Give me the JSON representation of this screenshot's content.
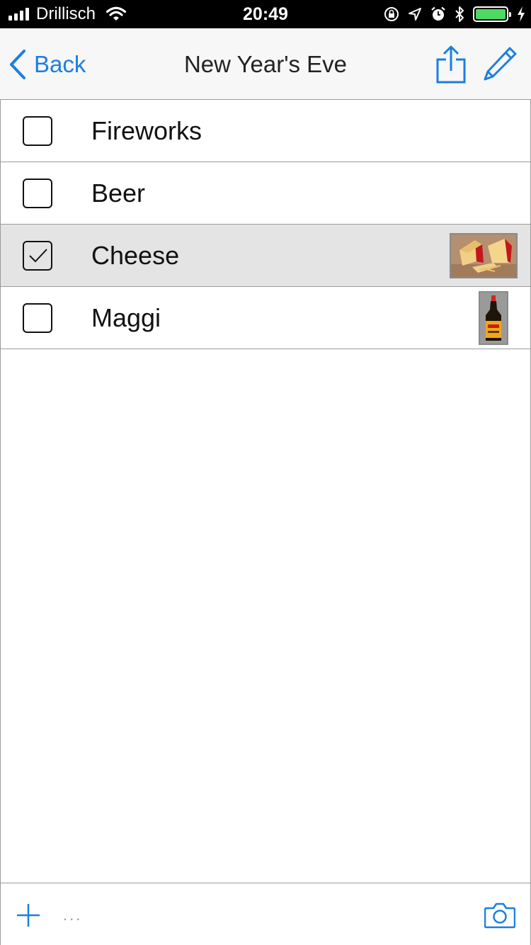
{
  "status_bar": {
    "carrier": "Drillisch",
    "time": "20:49",
    "battery_color": "#4cd964"
  },
  "nav": {
    "back_label": "Back",
    "title": "New Year's Eve",
    "accent_color": "#1a7fe0"
  },
  "items": [
    {
      "label": "Fireworks",
      "checked": false,
      "thumbnail": null
    },
    {
      "label": "Beer",
      "checked": false,
      "thumbnail": null
    },
    {
      "label": "Cheese",
      "checked": true,
      "thumbnail": "cheese-photo"
    },
    {
      "label": "Maggi",
      "checked": false,
      "thumbnail": "maggi-bottle-photo"
    }
  ],
  "toolbar": {
    "more_label": "..."
  }
}
